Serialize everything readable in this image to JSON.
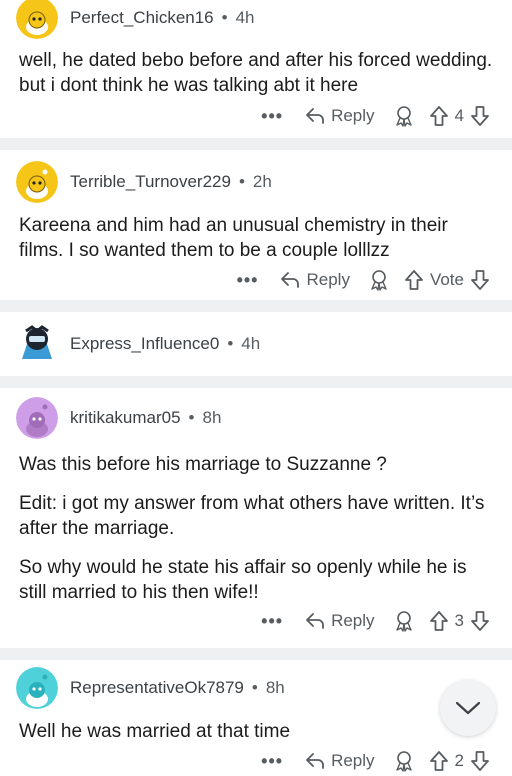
{
  "comments": [
    {
      "username": "Perfect_Chicken16",
      "time": "4h",
      "paragraphs": [
        "well, he dated bebo before and after his forced wedding. but i dont think he was talking abt it here"
      ],
      "more": "•••",
      "reply_label": "Reply",
      "votes": "4",
      "avatar_color": "#f5c518"
    },
    {
      "username": "Terrible_Turnover229",
      "time": "2h",
      "paragraphs": [
        "Kareena and him had an unusual chemistry in their films. I so wanted them to be a couple lolllzz"
      ],
      "more": "•••",
      "reply_label": "Reply",
      "votes": "Vote",
      "avatar_color": "#f5c518"
    },
    {
      "username": "Express_Influence0",
      "time": "4h",
      "avatar_color": "#3a9bd6"
    },
    {
      "username": "kritikakumar05",
      "time": "8h",
      "paragraphs": [
        "Was this before his marriage to Suzzanne ?",
        "Edit: i got my answer from what others have written. It’s after the marriage.",
        "So why would he state his affair so openly while he is still married to his then wife!!"
      ],
      "more": "•••",
      "reply_label": "Reply",
      "votes": "3",
      "avatar_color": "#cf9ee8"
    },
    {
      "username": "RepresentativeOk7879",
      "time": "8h",
      "paragraphs": [
        "Well he was married at that time"
      ],
      "more": "•••",
      "reply_label": "Reply",
      "votes": "2",
      "avatar_color": "#4fd1d9"
    }
  ],
  "separator": "•",
  "icons": {
    "reply": "reply-arrow-icon",
    "award": "award-icon",
    "upvote": "upvote-arrow-icon",
    "downvote": "downvote-arrow-icon",
    "scroll": "chevron-down-icon"
  }
}
